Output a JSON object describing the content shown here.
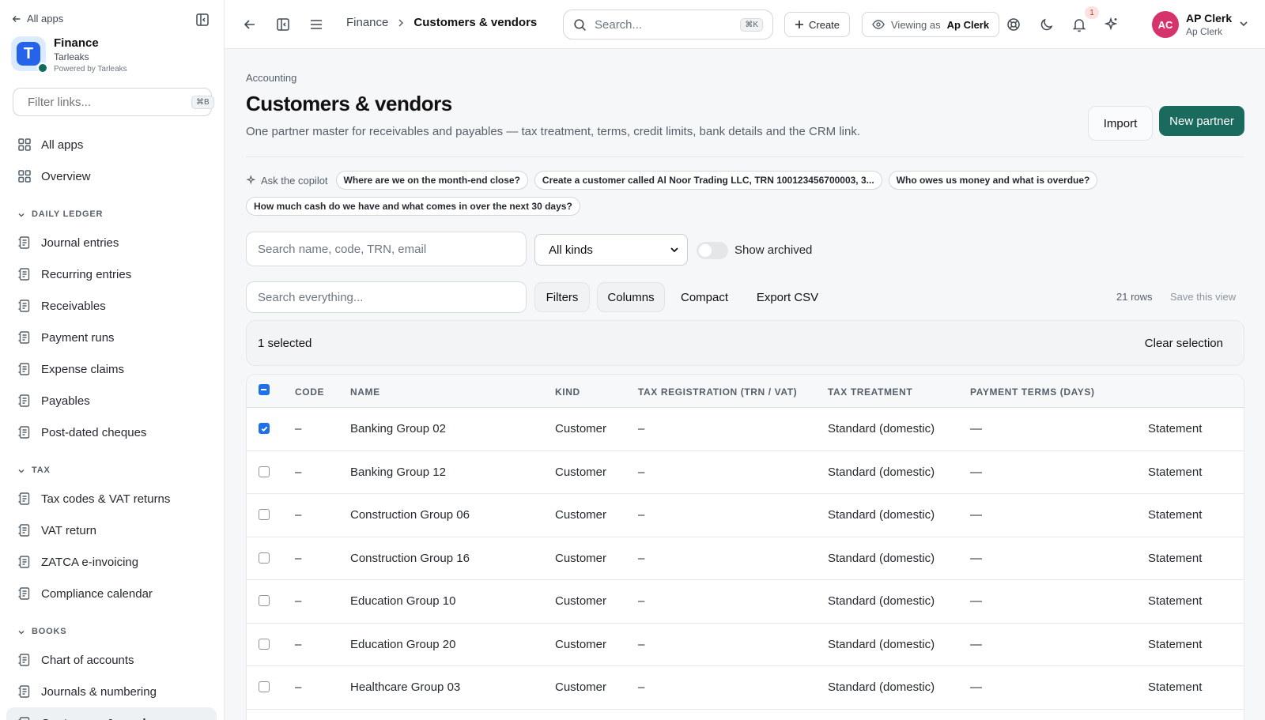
{
  "sidebar": {
    "back_label": "All apps",
    "brand": {
      "initial": "T",
      "name": "Finance",
      "org": "Tarleaks",
      "powered": "Powered by Tarleaks"
    },
    "filter": {
      "placeholder": "Filter links...",
      "shortcut": "⌘B"
    },
    "top_items": [
      {
        "label": "All apps",
        "icon": "grid-icon"
      },
      {
        "label": "Overview",
        "icon": "grid-icon"
      }
    ],
    "sections": [
      {
        "title": "DAILY LEDGER",
        "items": [
          "Journal entries",
          "Recurring entries",
          "Receivables",
          "Payment runs",
          "Expense claims",
          "Payables",
          "Post-dated cheques"
        ]
      },
      {
        "title": "TAX",
        "items": [
          "Tax codes & VAT returns",
          "VAT return",
          "ZATCA e-invoicing",
          "Compliance calendar"
        ]
      },
      {
        "title": "BOOKS",
        "items": [
          "Chart of accounts",
          "Journals & numbering",
          "Customers & vendors"
        ]
      }
    ],
    "active_item": "Customers & vendors"
  },
  "topbar": {
    "breadcrumb": [
      "Finance",
      "Customers & vendors"
    ],
    "search_placeholder": "Search...",
    "search_shortcut": "⌘K",
    "create_label": "Create",
    "viewing_prefix": "Viewing as",
    "viewing_user": "Ap Clerk",
    "notification_count": "1",
    "avatar_initials": "AC",
    "user_name": "AP Clerk",
    "user_role": "Ap Clerk"
  },
  "page": {
    "kicker": "Accounting",
    "title": "Customers & vendors",
    "description": "One partner master for receivables and payables — tax treatment, terms, credit limits, bank details and the CRM link.",
    "import_label": "Import",
    "new_label": "New partner"
  },
  "copilot": {
    "label": "Ask the copilot",
    "chips": [
      "Where are we on the month-end close?",
      "Create a customer called Al Noor Trading LLC, TRN 100123456700003, 3...",
      "Who owes us money and what is overdue?",
      "How much cash do we have and what comes in over the next 30 days?"
    ]
  },
  "filters": {
    "search_placeholder": "Search name, code, TRN, email",
    "kind_selected": "All kinds",
    "show_archived_label": "Show archived",
    "show_archived": false,
    "global_search_placeholder": "Search everything...",
    "filters_label": "Filters",
    "columns_label": "Columns",
    "compact_label": "Compact",
    "export_label": "Export CSV",
    "row_count": "21 rows",
    "save_view_label": "Save this view"
  },
  "selection": {
    "text": "1 selected",
    "clear_label": "Clear selection"
  },
  "table": {
    "columns": [
      "CODE",
      "NAME",
      "KIND",
      "TAX REGISTRATION (TRN / VAT)",
      "TAX TREATMENT",
      "PAYMENT TERMS (DAYS)"
    ],
    "rows": [
      {
        "checked": true,
        "code": "–",
        "name": "Banking Group 02",
        "kind": "Customer",
        "trn": "–",
        "treatment": "Standard (domestic)",
        "terms": "—",
        "action": "Statement"
      },
      {
        "checked": false,
        "code": "–",
        "name": "Banking Group 12",
        "kind": "Customer",
        "trn": "–",
        "treatment": "Standard (domestic)",
        "terms": "—",
        "action": "Statement"
      },
      {
        "checked": false,
        "code": "–",
        "name": "Construction Group 06",
        "kind": "Customer",
        "trn": "–",
        "treatment": "Standard (domestic)",
        "terms": "—",
        "action": "Statement"
      },
      {
        "checked": false,
        "code": "–",
        "name": "Construction Group 16",
        "kind": "Customer",
        "trn": "–",
        "treatment": "Standard (domestic)",
        "terms": "—",
        "action": "Statement"
      },
      {
        "checked": false,
        "code": "–",
        "name": "Education Group 10",
        "kind": "Customer",
        "trn": "–",
        "treatment": "Standard (domestic)",
        "terms": "—",
        "action": "Statement"
      },
      {
        "checked": false,
        "code": "–",
        "name": "Education Group 20",
        "kind": "Customer",
        "trn": "–",
        "treatment": "Standard (domestic)",
        "terms": "—",
        "action": "Statement"
      },
      {
        "checked": false,
        "code": "–",
        "name": "Healthcare Group 03",
        "kind": "Customer",
        "trn": "–",
        "treatment": "Standard (domestic)",
        "terms": "—",
        "action": "Statement"
      }
    ]
  },
  "colors": {
    "accent": "#1a6b5e",
    "avatar": "#d6336c",
    "checkbox": "#1f6feb",
    "brand": "#2563eb"
  }
}
